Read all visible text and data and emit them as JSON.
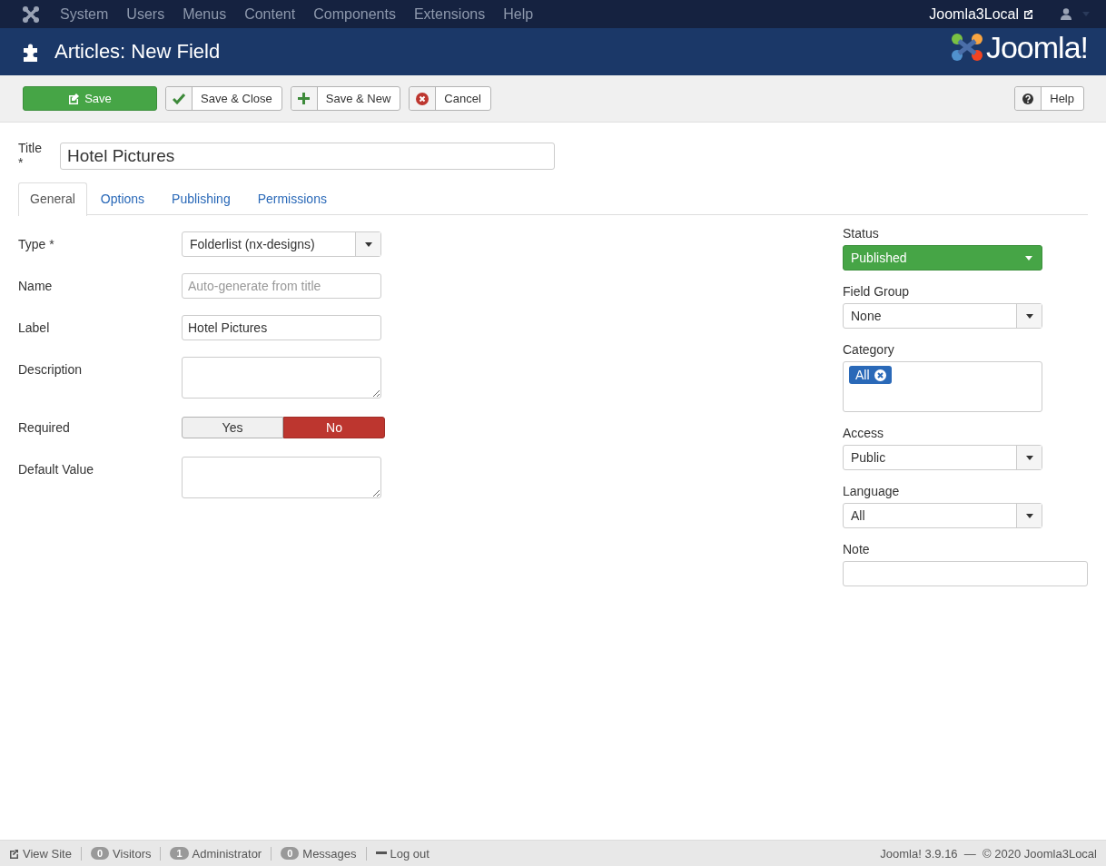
{
  "topnav": {
    "menu": [
      "System",
      "Users",
      "Menus",
      "Content",
      "Components",
      "Extensions",
      "Help"
    ],
    "site_link": "Joomla3Local"
  },
  "header": {
    "title": "Articles: New Field",
    "logo": "Joomla!"
  },
  "toolbar": {
    "buttons": [
      {
        "kind": "save",
        "label": "Save"
      },
      {
        "kind": "apply",
        "label": "Save & Close"
      },
      {
        "kind": "new",
        "label": "Save & New"
      },
      {
        "kind": "cancel",
        "label": "Cancel"
      }
    ],
    "help": "Help"
  },
  "title_field": {
    "label": "Title *",
    "value": "Hotel Pictures"
  },
  "tabs": [
    {
      "label": "General",
      "selected": true
    },
    {
      "label": "Options",
      "selected": false
    },
    {
      "label": "Publishing",
      "selected": false
    },
    {
      "label": "Permissions",
      "selected": false
    }
  ],
  "fields": [
    {
      "kind": "select",
      "label": "Type *",
      "value": "Folderlist (nx-designs)"
    },
    {
      "kind": "text",
      "label": "Name",
      "placeholder": "Auto-generate from title"
    },
    {
      "kind": "text",
      "label": "Label",
      "value": "Hotel Pictures"
    },
    {
      "kind": "textarea",
      "label": "Description"
    },
    {
      "kind": "toggle",
      "label": "Required",
      "options": [
        {
          "label": "Yes",
          "selected": false
        },
        {
          "label": "No",
          "selected": true
        }
      ]
    },
    {
      "kind": "textarea",
      "label": "Default Value"
    }
  ],
  "side_fields": [
    {
      "kind": "status",
      "label": "Status",
      "value": "Published"
    },
    {
      "kind": "select",
      "label": "Field Group",
      "value": "None"
    },
    {
      "kind": "tags",
      "label": "Category",
      "tags": [
        "All"
      ]
    },
    {
      "kind": "select",
      "label": "Access",
      "value": "Public"
    },
    {
      "kind": "select",
      "label": "Language",
      "value": "All"
    },
    {
      "kind": "text",
      "label": "Note"
    }
  ],
  "footer": {
    "items": [
      {
        "kind": "link",
        "label": "View Site"
      },
      {
        "kind": "count",
        "count": "0",
        "label": "Visitors"
      },
      {
        "kind": "count",
        "count": "1",
        "label": "Administrator"
      },
      {
        "kind": "count",
        "count": "0",
        "label": "Messages"
      },
      {
        "kind": "logout",
        "label": "Log out"
      }
    ],
    "copyright": "Joomla! 3.9.16  —  © 2020 Joomla3Local"
  }
}
